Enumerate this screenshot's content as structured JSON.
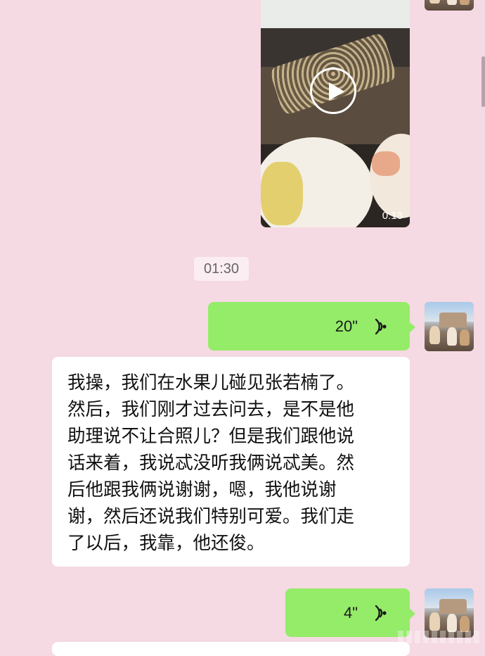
{
  "video_message": {
    "duration": "0:13",
    "play_icon": "play-icon"
  },
  "timestamp": "01:30",
  "voice_messages": [
    {
      "duration": "20\"",
      "icon": "voice-wave-icon"
    },
    {
      "duration": "4\"",
      "icon": "voice-wave-icon"
    }
  ],
  "text_message": {
    "lines": [
      "我操，我们在水果儿碰见张若楠了。",
      "然后，我们刚才过去问去，是不是他",
      "助理说不让合照儿？但是我们跟他说",
      "话来着，我说忒没听我俩说忒美。然",
      "后他跟我俩说谢谢，嗯，我他说谢",
      "谢，然后还说我们特别可爱。我们走",
      "了以后，我靠，他还俊。"
    ]
  },
  "colors": {
    "background": "#f5d9e3",
    "outgoing_bubble": "#95ec69",
    "incoming_bubble": "#ffffff"
  }
}
